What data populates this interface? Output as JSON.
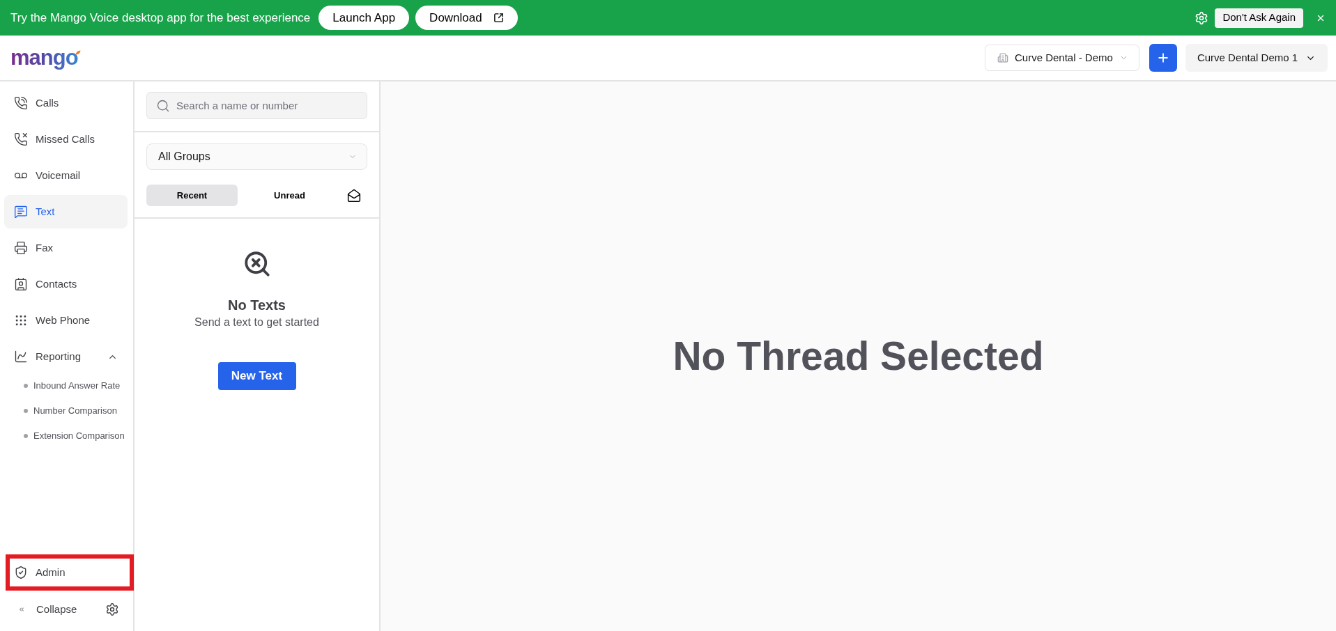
{
  "banner": {
    "message": "Try the Mango Voice desktop app for the best experience",
    "buttons": [
      {
        "label": "Launch App",
        "kind": "plain"
      },
      {
        "label": "Download",
        "kind": "external"
      }
    ],
    "dismiss_button": "Don't Ask Again"
  },
  "header": {
    "logo": "mango",
    "location_select": {
      "value": "Curve Dental - Demo"
    },
    "account_menu": {
      "label": "Curve Dental Demo 1"
    }
  },
  "sidebar": {
    "items": [
      {
        "label": "Calls",
        "selected": false
      },
      {
        "label": "Missed Calls",
        "selected": false
      },
      {
        "label": "Voicemail",
        "selected": false
      },
      {
        "label": "Text",
        "selected": true
      },
      {
        "label": "Fax",
        "selected": false
      },
      {
        "label": "Contacts",
        "selected": false
      },
      {
        "label": "Web Phone",
        "selected": false
      },
      {
        "label": "Reporting",
        "selected": false,
        "expanded": true,
        "children": [
          {
            "label": "Inbound Answer Rate",
            "selected": false
          },
          {
            "label": "Number Comparison",
            "selected": false
          },
          {
            "label": "Extension Comparison",
            "selected": false
          }
        ]
      }
    ],
    "admin": {
      "label": "Admin",
      "highlighted": true
    },
    "collapse": {
      "label": "Collapse"
    }
  },
  "threads_panel": {
    "search": {
      "placeholder": "Search a name or number"
    },
    "group_select": {
      "value": "All Groups"
    },
    "tabs": [
      {
        "label": "Recent",
        "selected": true
      },
      {
        "label": "Unread",
        "selected": false
      }
    ],
    "empty_state": {
      "title": "No Texts",
      "message": "Send a text to get started",
      "button": "New Text"
    }
  },
  "thread_view": {
    "title": "No Thread Selected"
  }
}
